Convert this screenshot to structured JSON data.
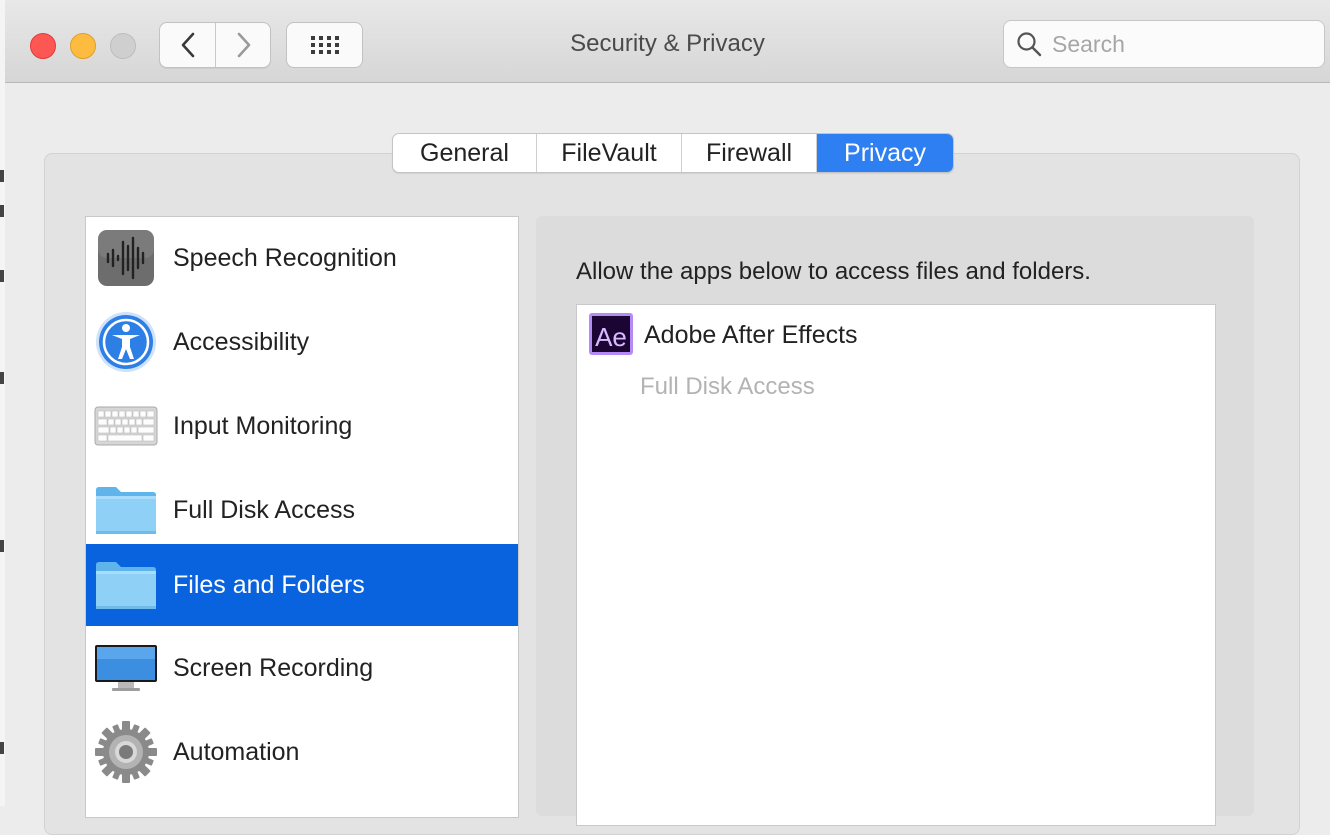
{
  "window": {
    "title": "Security & Privacy"
  },
  "search": {
    "placeholder": "Search",
    "value": ""
  },
  "tabs": [
    {
      "label": "General",
      "active": false
    },
    {
      "label": "FileVault",
      "active": false
    },
    {
      "label": "Firewall",
      "active": false
    },
    {
      "label": "Privacy",
      "active": true
    }
  ],
  "sidebar": {
    "items": [
      {
        "label": "Speech Recognition",
        "icon": "waveform-icon",
        "selected": false
      },
      {
        "label": "Accessibility",
        "icon": "accessibility-icon",
        "selected": false
      },
      {
        "label": "Input Monitoring",
        "icon": "keyboard-icon",
        "selected": false
      },
      {
        "label": "Full Disk Access",
        "icon": "folder-icon",
        "selected": false
      },
      {
        "label": "Files and Folders",
        "icon": "folder-icon",
        "selected": true
      },
      {
        "label": "Screen Recording",
        "icon": "monitor-icon",
        "selected": false
      },
      {
        "label": "Automation",
        "icon": "gear-icon",
        "selected": false
      }
    ]
  },
  "panel": {
    "heading": "Allow the apps below to access files and folders.",
    "apps": [
      {
        "name": "Adobe After Effects",
        "icon_text": "Ae",
        "sub": "Full Disk Access"
      }
    ]
  },
  "colors": {
    "accent": "#2e7ff2",
    "selection": "#0a63de",
    "close": "#fc5753",
    "minimize": "#fdbc40",
    "zoom_disabled": "#cfcfcf",
    "ae_border": "#b48af7",
    "ae_bg": "#1a0533"
  }
}
